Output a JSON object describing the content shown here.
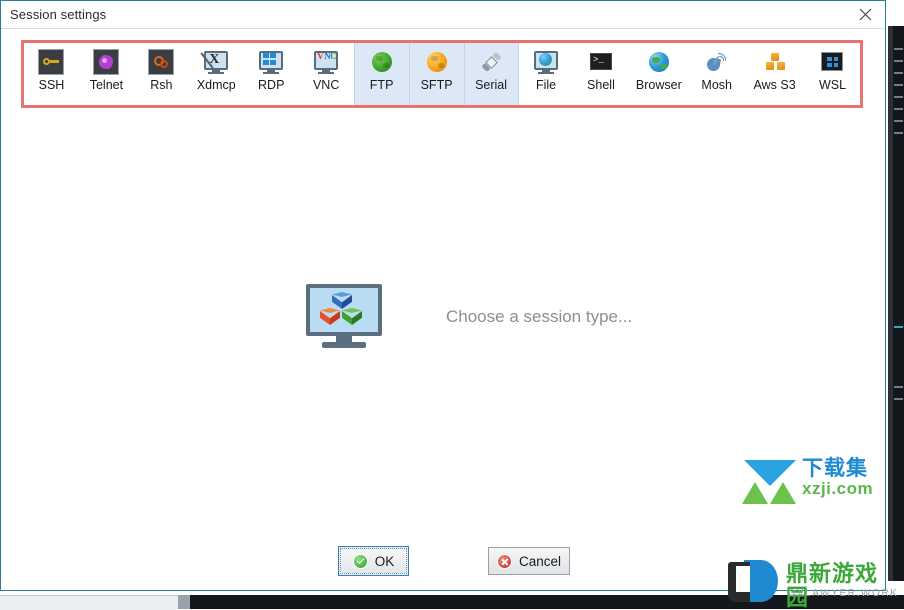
{
  "window": {
    "title": "Session settings",
    "close_icon": "close-icon"
  },
  "toolbar": {
    "items": [
      {
        "label": "SSH",
        "icon": "ssh-key-icon",
        "selected": false
      },
      {
        "label": "Telnet",
        "icon": "telnet-icon",
        "selected": false
      },
      {
        "label": "Rsh",
        "icon": "rsh-gear-icon",
        "selected": false
      },
      {
        "label": "Xdmcp",
        "icon": "xdmcp-monitor-icon",
        "selected": false
      },
      {
        "label": "RDP",
        "icon": "rdp-monitor-icon",
        "selected": false
      },
      {
        "label": "VNC",
        "icon": "vnc-monitor-icon",
        "selected": false
      },
      {
        "label": "FTP",
        "icon": "ftp-globe-icon",
        "selected": true
      },
      {
        "label": "SFTP",
        "icon": "sftp-globe-icon",
        "selected": true
      },
      {
        "label": "Serial",
        "icon": "serial-plug-icon",
        "selected": true
      },
      {
        "label": "File",
        "icon": "file-monitor-icon",
        "selected": false
      },
      {
        "label": "Shell",
        "icon": "shell-terminal-icon",
        "selected": false
      },
      {
        "label": "Browser",
        "icon": "browser-globe-icon",
        "selected": false
      },
      {
        "label": "Mosh",
        "icon": "mosh-dish-icon",
        "selected": false
      },
      {
        "label": "Aws S3",
        "icon": "aws-s3-icon",
        "selected": false
      },
      {
        "label": "WSL",
        "icon": "wsl-windows-icon",
        "selected": false
      }
    ],
    "highlight_color": "#e8736e",
    "selection_color": "#dce8f6"
  },
  "main": {
    "placeholder_text": "Choose a session type...",
    "placeholder_icon": "monitor-cubes-icon"
  },
  "buttons": {
    "ok": {
      "label": "OK",
      "icon": "check-circle-icon"
    },
    "cancel": {
      "label": "Cancel",
      "icon": "x-circle-icon"
    }
  },
  "watermarks": {
    "one": {
      "cn": "下载集",
      "en": "xzji.com"
    },
    "two": {
      "cn": "鼎新游戏园",
      "en": "DXLAWYER.WORK"
    }
  }
}
